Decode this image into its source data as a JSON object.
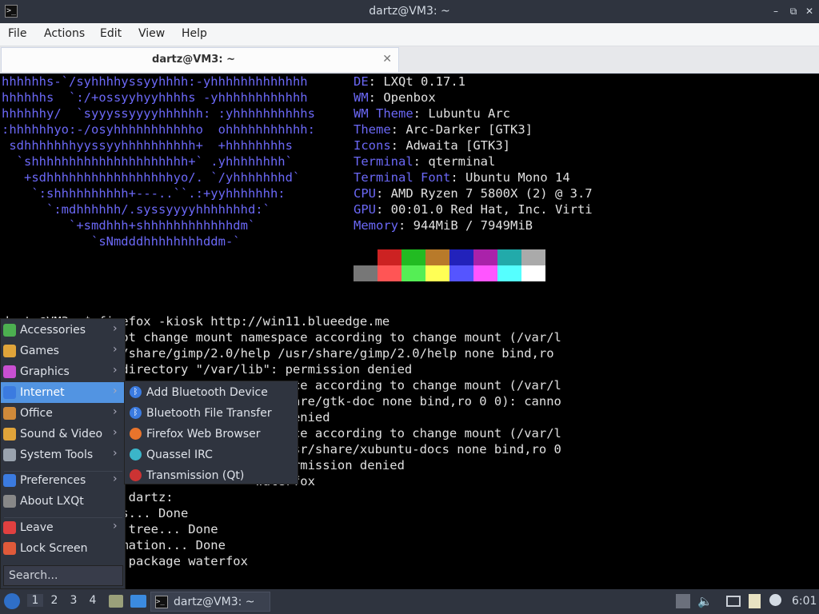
{
  "window": {
    "title": "dartz@VM3: ~",
    "minimize_icon": "–",
    "maximize_icon": "⧉",
    "close_icon": "✕"
  },
  "menubar": [
    "File",
    "Actions",
    "Edit",
    "View",
    "Help"
  ],
  "tab": {
    "label": "dartz@VM3: ~",
    "close": "✕"
  },
  "terminal": {
    "ascii_art": "hhhhhhs-`/syhhhhyssyyhhhh:-yhhhhhhhhhhhhh\nhhhhhhs  `:/+ossyyhyyhhhhs -yhhhhhhhhhhhh\nhhhhhhy/  `syyyssyyyyhhhhhh: :yhhhhhhhhhhs\n:hhhhhhyo:-/osyhhhhhhhhhhho  ohhhhhhhhhhh:\n sdhhhhhhhyyssyyhhhhhhhhhh+  +hhhhhhhhs\n  `shhhhhhhhhhhhhhhhhhhhh+` .yhhhhhhhh`\n   +sdhhhhhhhhhhhhhhhhhyo/. `/yhhhhhhhd`\n    `:shhhhhhhhhh+---..``.:+yyhhhhhhh:\n      `:mdhhhhhh/.syssyyyyhhhhhhhd:`\n         `+smdhhh+shhhhhhhhhhhhdm`\n            `sNmdddhhhhhhhhddm-`",
    "info": [
      {
        "key": "DE",
        "value": "LXQt 0.17.1"
      },
      {
        "key": "WM",
        "value": "Openbox"
      },
      {
        "key": "WM Theme",
        "value": "Lubuntu Arc"
      },
      {
        "key": "Theme",
        "value": "Arc-Darker [GTK3]"
      },
      {
        "key": "Icons",
        "value": "Adwaita [GTK3]"
      },
      {
        "key": "Terminal",
        "value": "qterminal"
      },
      {
        "key": "Terminal Font",
        "value": "Ubuntu Mono 14"
      },
      {
        "key": "CPU",
        "value": "AMD Ryzen 7 5800X (2) @ 3.7"
      },
      {
        "key": "GPU",
        "value": "00:01.0 Red Hat, Inc. Virti"
      },
      {
        "key": "Memory",
        "value": "944MiB / 7949MiB"
      }
    ],
    "palette_top": [
      "#000000",
      "#cc2222",
      "#22bb22",
      "#b87a2a",
      "#2222bb",
      "#aa22aa",
      "#22aaaa",
      "#aaaaaa"
    ],
    "palette_bottom": [
      "#777777",
      "#ff5555",
      "#55ee55",
      "#ffff55",
      "#5555ff",
      "#ff55ff",
      "#55ffff",
      "#ffffff"
    ],
    "output": "dartz@VM3:~$ firefox -kiosk http://win11.blueedge.me\n            cannot change mount namespace according to change mount (/var/l\n            /usr/share/gimp/2.0/help /usr/share/gimp/2.0/help none bind,ro\n            pen directory \"/var/lib\": permission denied\n                                   espace according to change mount (/var/l\n                                   r/share/gtk-doc none bind,ro 0 0): canno\n                                   on denied\n                                   espace according to change mount (/var/l\n                                   s /usr/share/xubuntu-docs none bind,ro 0\n                                   : permission denied\n                                  waterfox\n             for dartz:\n            lists... Done\n            ency tree... Done\n            nformation... Done\n            tate package waterfox"
  },
  "launcher": {
    "items": [
      {
        "label": "Accessories",
        "icon": "accessories-icon",
        "color": "#4caf50",
        "arrow": "›"
      },
      {
        "label": "Games",
        "icon": "games-icon",
        "color": "#e0a43a",
        "arrow": "›"
      },
      {
        "label": "Graphics",
        "icon": "graphics-icon",
        "color": "#c94fd1",
        "arrow": "›"
      },
      {
        "label": "Internet",
        "icon": "internet-icon",
        "color": "#3b7be0",
        "arrow": "›"
      },
      {
        "label": "Office",
        "icon": "office-icon",
        "color": "#d08a3a",
        "arrow": "›"
      },
      {
        "label": "Sound & Video",
        "icon": "sound-video-icon",
        "color": "#e0a43a",
        "arrow": "›"
      },
      {
        "label": "System Tools",
        "icon": "system-tools-icon",
        "color": "#9aa3ae",
        "arrow": "›"
      }
    ],
    "items2": [
      {
        "label": "Preferences",
        "icon": "preferences-icon",
        "color": "#3b7be0",
        "arrow": "›"
      },
      {
        "label": "About LXQt",
        "icon": "about-icon",
        "color": "#888888",
        "arrow": ""
      }
    ],
    "items3": [
      {
        "label": "Leave",
        "icon": "leave-icon",
        "color": "#e04040",
        "arrow": "›"
      },
      {
        "label": "Lock Screen",
        "icon": "lock-screen-icon",
        "color": "#e05a3a",
        "arrow": ""
      }
    ],
    "search_placeholder": "Search..."
  },
  "internet_submenu": [
    {
      "label": "Add Bluetooth Device",
      "icon": "bluetooth-icon",
      "color": "#3b7be0",
      "glyph": "ᛒ"
    },
    {
      "label": "Bluetooth File Transfer",
      "icon": "bluetooth-icon",
      "color": "#3b7be0",
      "glyph": "ᛒ"
    },
    {
      "label": "Firefox Web Browser",
      "icon": "firefox-icon",
      "color": "#e8742c",
      "glyph": ""
    },
    {
      "label": "Quassel IRC",
      "icon": "quassel-icon",
      "color": "#3bb5c9",
      "glyph": ""
    },
    {
      "label": "Transmission (Qt)",
      "icon": "transmission-icon",
      "color": "#cc3333",
      "glyph": ""
    }
  ],
  "taskbar": {
    "workspaces": [
      "1",
      "2",
      "3",
      "4"
    ],
    "task_label": "dartz@VM3: ~",
    "clock": "6:01"
  }
}
